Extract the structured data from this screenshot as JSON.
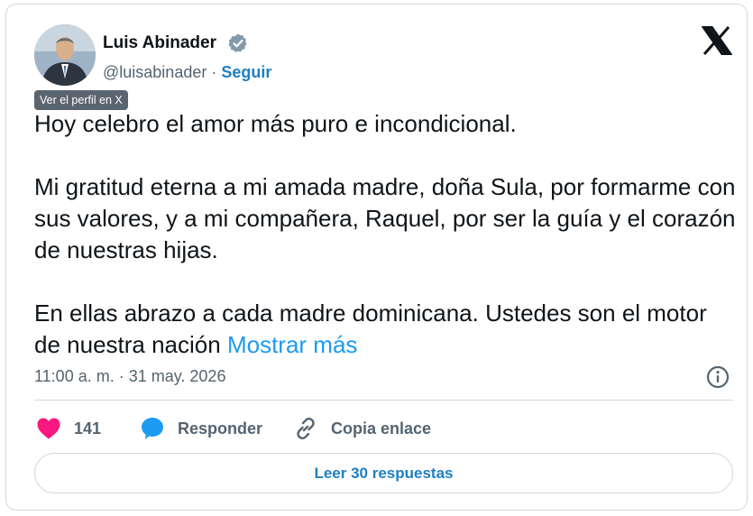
{
  "author": {
    "name": "Luis Abinader",
    "handle": "@luisabinader",
    "separator": "·",
    "follow_label": "Seguir"
  },
  "tooltip": "Ver el perfil en X",
  "tweet": {
    "paragraphs": [
      "Hoy celebro el amor más puro e incondicional.",
      "Mi gratitud eterna a mi amada madre, doña Sula, por formarme con sus valores, y a mi compañera, Raquel, por ser la guía y el corazón de nuestras hijas.",
      "En ellas abrazo a cada madre dominicana. Ustedes son el motor de nuestra nación"
    ],
    "show_more": "Mostrar más",
    "timestamp": "11:00 a. m. · 31 may. 2026"
  },
  "actions": {
    "likes": "141",
    "reply_label": "Responder",
    "copy_label": "Copia enlace"
  },
  "read_replies": "Leer 30 respuestas",
  "icons": {
    "verified": "verified-badge-icon",
    "logo": "x-logo-icon",
    "info": "info-icon",
    "like": "heart-icon",
    "reply": "speech-bubble-icon",
    "copy": "link-icon"
  },
  "colors": {
    "link": "#1d9bf0",
    "follow": "#1d7fc4",
    "like": "#f91880",
    "reply": "#1d9bf0",
    "muted": "#536471"
  }
}
